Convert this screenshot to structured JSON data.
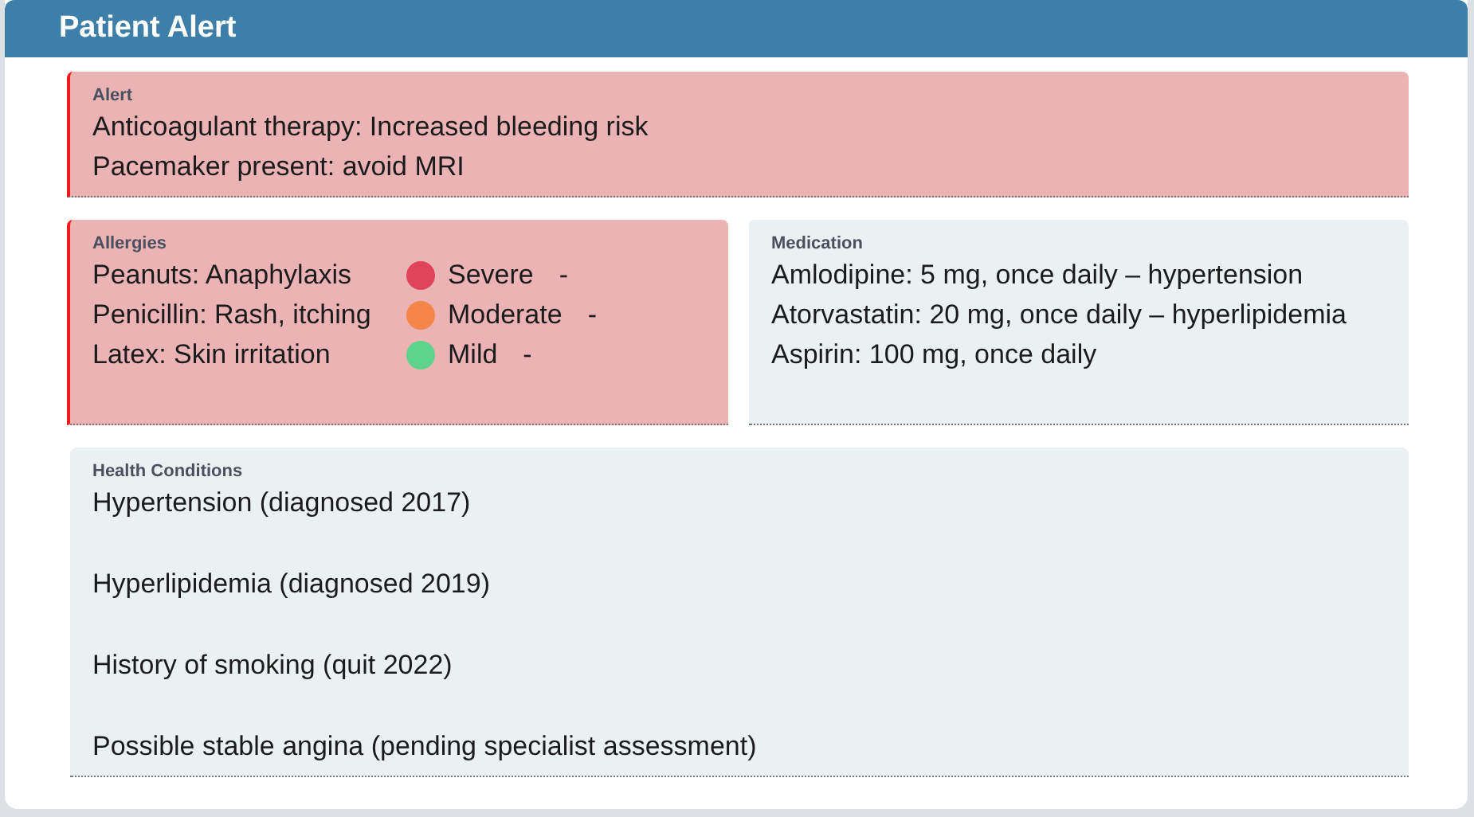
{
  "header": {
    "title": "Patient Alert"
  },
  "alert": {
    "label": "Alert",
    "lines": [
      "Anticoagulant therapy: Increased bleeding risk",
      "Pacemaker present: avoid MRI"
    ]
  },
  "allergies": {
    "label": "Allergies",
    "items": [
      {
        "name": "Peanuts: Anaphylaxis",
        "severity": "Severe",
        "color": "#e0435a",
        "note": "-"
      },
      {
        "name": "Penicillin: Rash, itching",
        "severity": "Moderate",
        "color": "#f5864a",
        "note": "-"
      },
      {
        "name": "Latex: Skin irritation",
        "severity": "Mild",
        "color": "#5ed48c",
        "note": "-"
      }
    ]
  },
  "medication": {
    "label": "Medication",
    "lines": [
      "Amlodipine: 5 mg, once daily – hypertension",
      "Atorvastatin: 20 mg, once daily – hyperlipidemia",
      "Aspirin: 100 mg, once daily"
    ]
  },
  "conditions": {
    "label": "Health Conditions",
    "lines": [
      "Hypertension (diagnosed 2017)",
      "Hyperlipidemia (diagnosed 2019)",
      "History of smoking (quit 2022)",
      "Possible stable angina (pending specialist assessment)"
    ]
  }
}
